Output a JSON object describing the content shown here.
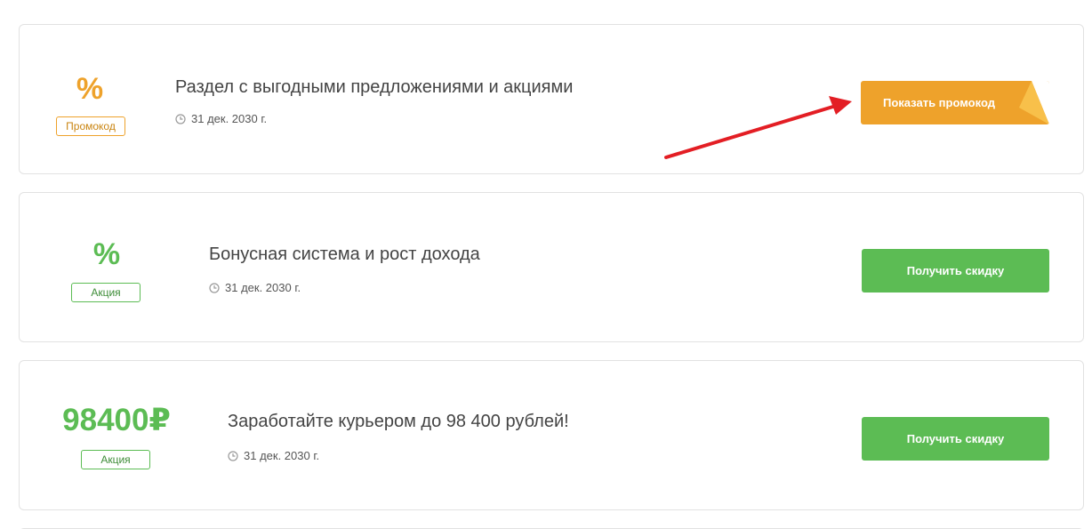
{
  "offers": [
    {
      "value": "%",
      "badge": "Промокод",
      "title": "Раздел с выгодными предложениями и акциями",
      "date": "31 дек. 2030 г.",
      "button": "Показать промокод",
      "accent": "#eea22b"
    },
    {
      "value": "%",
      "badge": "Акция",
      "title": "Бонусная система и рост дохода",
      "date": "31 дек. 2030 г.",
      "button": "Получить скидку",
      "accent": "#5cbc54"
    },
    {
      "value": "98400₽",
      "badge": "Акция",
      "title": "Заработайте курьером до 98 400 рублей!",
      "date": "31 дек. 2030 г.",
      "button": "Получить скидку",
      "accent": "#5cbc54"
    }
  ],
  "colors": {
    "promo_orange": "#eea22b",
    "action_green": "#5cbc54",
    "arrow_red": "#e31e24",
    "text": "#444444"
  },
  "icons": {
    "date": "clock-icon",
    "annotation": "red-arrow"
  }
}
